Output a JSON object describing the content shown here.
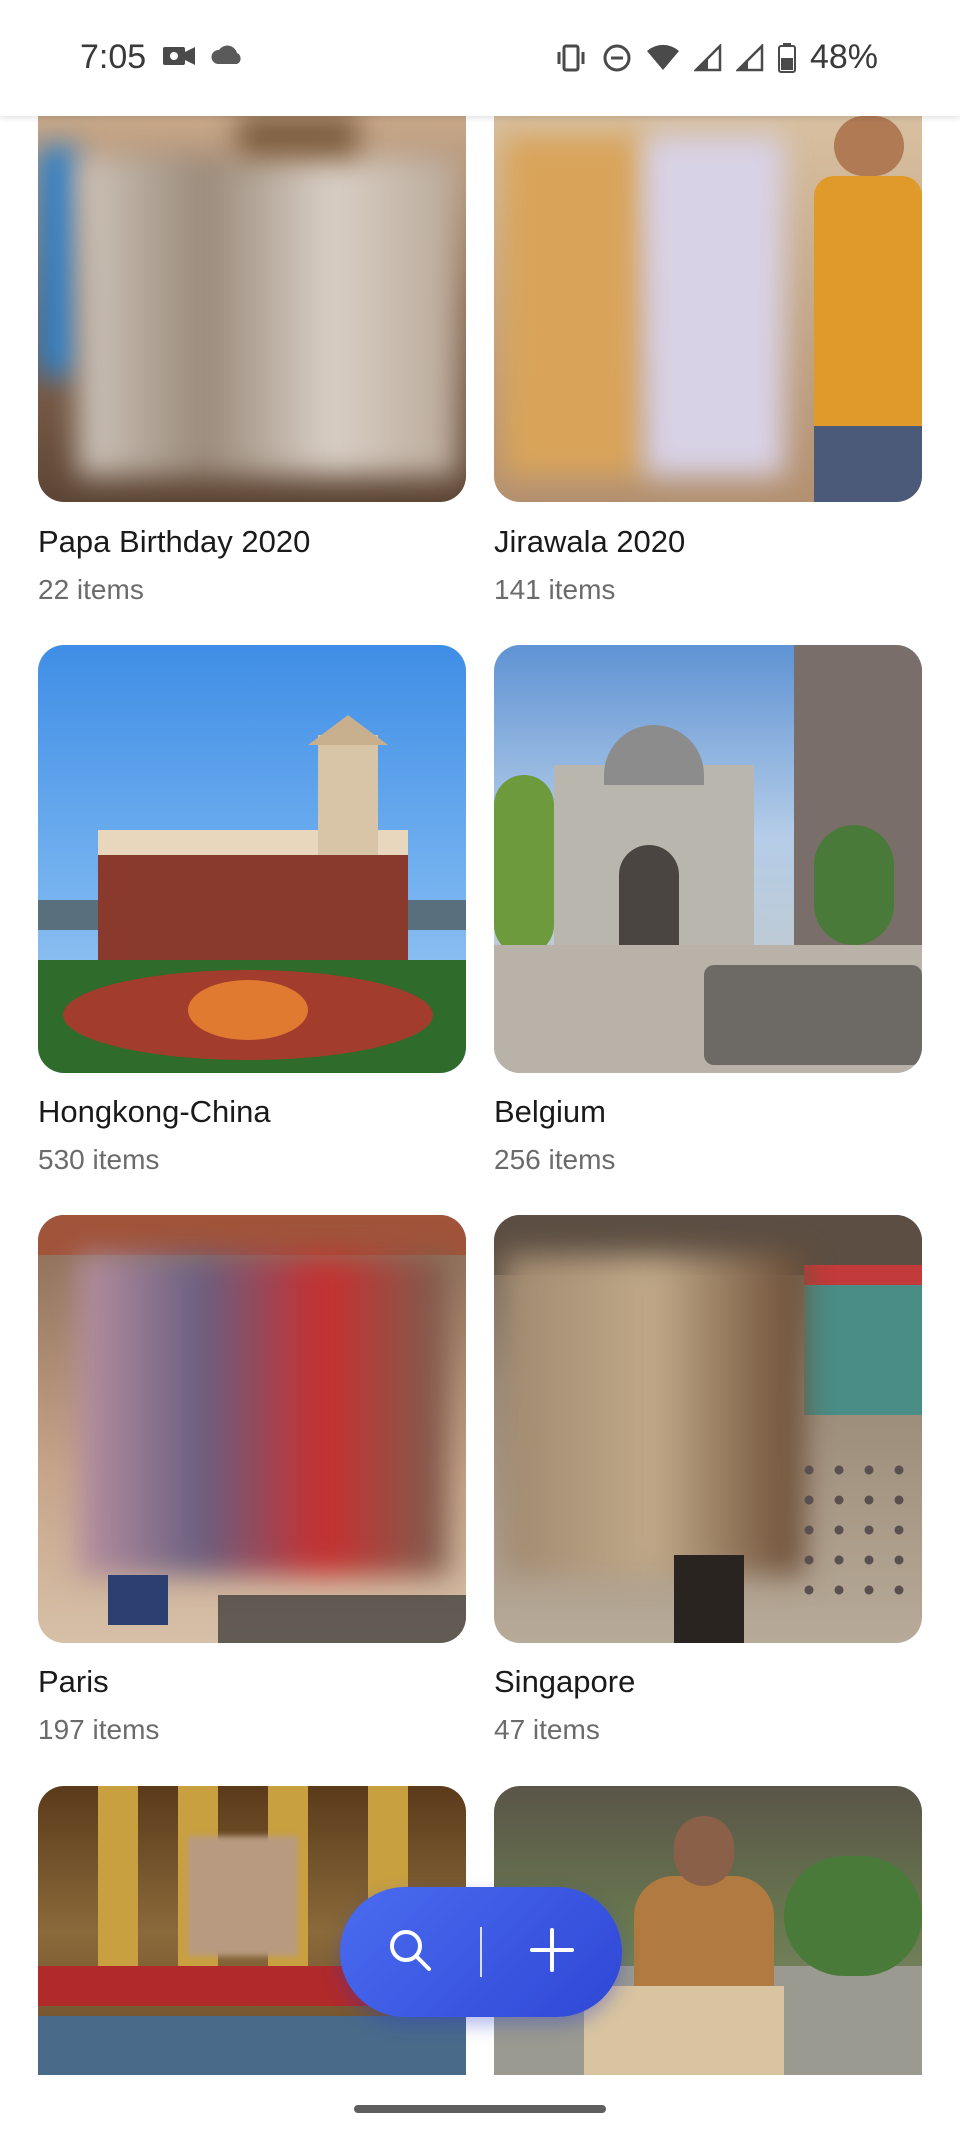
{
  "status_bar": {
    "time": "7:05",
    "battery": "48%",
    "left_icons": [
      "video-call-icon",
      "cloud-icon"
    ],
    "right_icons": [
      "vibrate-icon",
      "do-not-disturb-icon",
      "wifi-icon",
      "signal-icon",
      "signal-icon",
      "battery-icon"
    ]
  },
  "albums": [
    {
      "title": "Papa Birthday 2020",
      "count": "22 items"
    },
    {
      "title": "Jirawala 2020",
      "count": "141 items"
    },
    {
      "title": "Hongkong-China",
      "count": "530 items"
    },
    {
      "title": "Belgium",
      "count": "256 items"
    },
    {
      "title": "Paris",
      "count": "197 items"
    },
    {
      "title": "Singapore",
      "count": "47 items"
    },
    {
      "title": "",
      "count": ""
    },
    {
      "title": "",
      "count": ""
    }
  ],
  "fab": {
    "search_icon": "search-icon",
    "add_icon": "plus-icon",
    "color": "#3f5ee8"
  }
}
